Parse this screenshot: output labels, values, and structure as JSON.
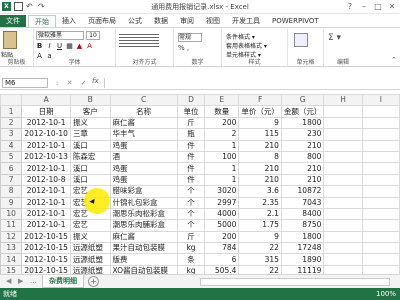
{
  "window": {
    "title": "通用费用报销记录.xlsx - Excel",
    "qa_logo": "X"
  },
  "tabs": [
    "文件",
    "开始",
    "插入",
    "页面布局",
    "公式",
    "数据",
    "审阅",
    "视图",
    "开发工具",
    "POWERPIVOT"
  ],
  "ribbon": {
    "paste": "粘贴",
    "clipboard": "剪贴板",
    "font_name": "微软雅黑",
    "font_size": "10",
    "font_group": "字体",
    "align_group": "对齐方式",
    "number_format": "常规",
    "number_symbols": "% ,",
    "number_group": "数字",
    "style_items": [
      "条件格式 ▾",
      "套用表格格式 ▾",
      "单元格样式 ▾"
    ],
    "style_group": "样式",
    "cells": "单元格",
    "editing": "编辑"
  },
  "formula_bar": {
    "name_box": "M6",
    "fx": "fx",
    "formula": ""
  },
  "columns": [
    "A",
    "B",
    "C",
    "D",
    "E",
    "F",
    "G",
    "H",
    "I"
  ],
  "rows": [
    {
      "n": "1",
      "a": "日期",
      "b": "客户",
      "c": "名称",
      "d": "单位",
      "e": "数量",
      "f": "单价（元）",
      "g": "金额（元）",
      "header": true
    },
    {
      "n": "2",
      "a": "2012-10-1",
      "b": "振义",
      "c": "麻仁酱",
      "d": "斤",
      "e": "200",
      "f": "9",
      "g": "1800"
    },
    {
      "n": "3",
      "a": "2012-10-10",
      "b": "三章",
      "c": "华丰气",
      "d": "瓶",
      "e": "2",
      "f": "115",
      "g": "230"
    },
    {
      "n": "4",
      "a": "2012-10-1",
      "b": "溪口",
      "c": "鸡蛋",
      "d": "件",
      "e": "1",
      "f": "210",
      "g": "210"
    },
    {
      "n": "5",
      "a": "2012-10-13",
      "b": "陈森宏",
      "c": "酒",
      "d": "件",
      "e": "100",
      "f": "8",
      "g": "800"
    },
    {
      "n": "6",
      "a": "2012-10-1",
      "b": "溪口",
      "c": "鸡蛋",
      "d": "件",
      "e": "1",
      "f": "210",
      "g": "210"
    },
    {
      "n": "7",
      "a": "2012-10-8",
      "b": "溪口",
      "c": "鸡蛋",
      "d": "件",
      "e": "1",
      "f": "210",
      "g": "210"
    },
    {
      "n": "8",
      "a": "2012-10-1",
      "b": "宏艺",
      "c": "腊味彩盒",
      "d": "个",
      "e": "3020",
      "f": "3.6",
      "g": "10872"
    },
    {
      "n": "9",
      "a": "2012-10-1",
      "b": "宏艺",
      "c": "什锦礼包彩盒",
      "d": "个",
      "e": "2997",
      "f": "2.35",
      "g": "7043"
    },
    {
      "n": "10",
      "a": "2012-10-1",
      "b": "宏艺",
      "c": "潮思乐肉松彩盒",
      "d": "个",
      "e": "4000",
      "f": "2.1",
      "g": "8400"
    },
    {
      "n": "11",
      "a": "2012-10-1",
      "b": "宏艺",
      "c": "潮思乐肉脯彩盒",
      "d": "个",
      "e": "5000",
      "f": "1.75",
      "g": "8750"
    },
    {
      "n": "12",
      "a": "2012-10-15",
      "b": "振义",
      "c": "麻仁酱",
      "d": "斤",
      "e": "200",
      "f": "9",
      "g": "1800"
    },
    {
      "n": "13",
      "a": "2012-10-15",
      "b": "远源纸塑",
      "c": "果汁自动包装膜",
      "d": "kg",
      "e": "784",
      "f": "22",
      "g": "17248"
    },
    {
      "n": "14",
      "a": "2012-10-15",
      "b": "远源纸塑",
      "c": "版费",
      "d": "条",
      "e": "6",
      "f": "315",
      "g": "1890"
    },
    {
      "n": "15",
      "a": "2012-10-15",
      "b": "远源纸塑",
      "c": "XO酱自动包装膜",
      "d": "kg",
      "e": "505.4",
      "f": "22",
      "g": "11119"
    }
  ],
  "sheet_tab": "杂费明细",
  "status": {
    "left": "就绪",
    "zoom": "100%"
  }
}
